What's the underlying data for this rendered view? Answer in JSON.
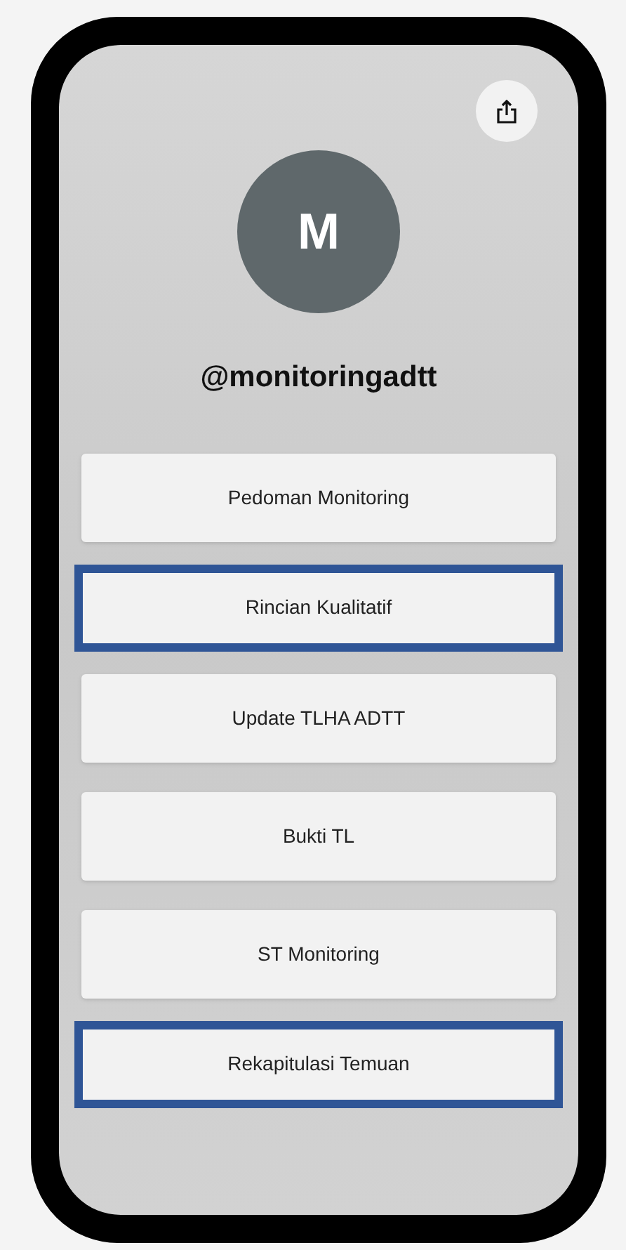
{
  "profile": {
    "avatar_letter": "M",
    "handle": "@monitoringadtt"
  },
  "links": [
    {
      "label": "Pedoman Monitoring",
      "highlighted": false
    },
    {
      "label": "Rincian Kualitatif",
      "highlighted": true
    },
    {
      "label": "Update TLHA ADTT",
      "highlighted": false
    },
    {
      "label": "Bukti TL",
      "highlighted": false
    },
    {
      "label": "ST Monitoring",
      "highlighted": false
    },
    {
      "label": "Rekapitulasi Temuan",
      "highlighted": true
    }
  ]
}
